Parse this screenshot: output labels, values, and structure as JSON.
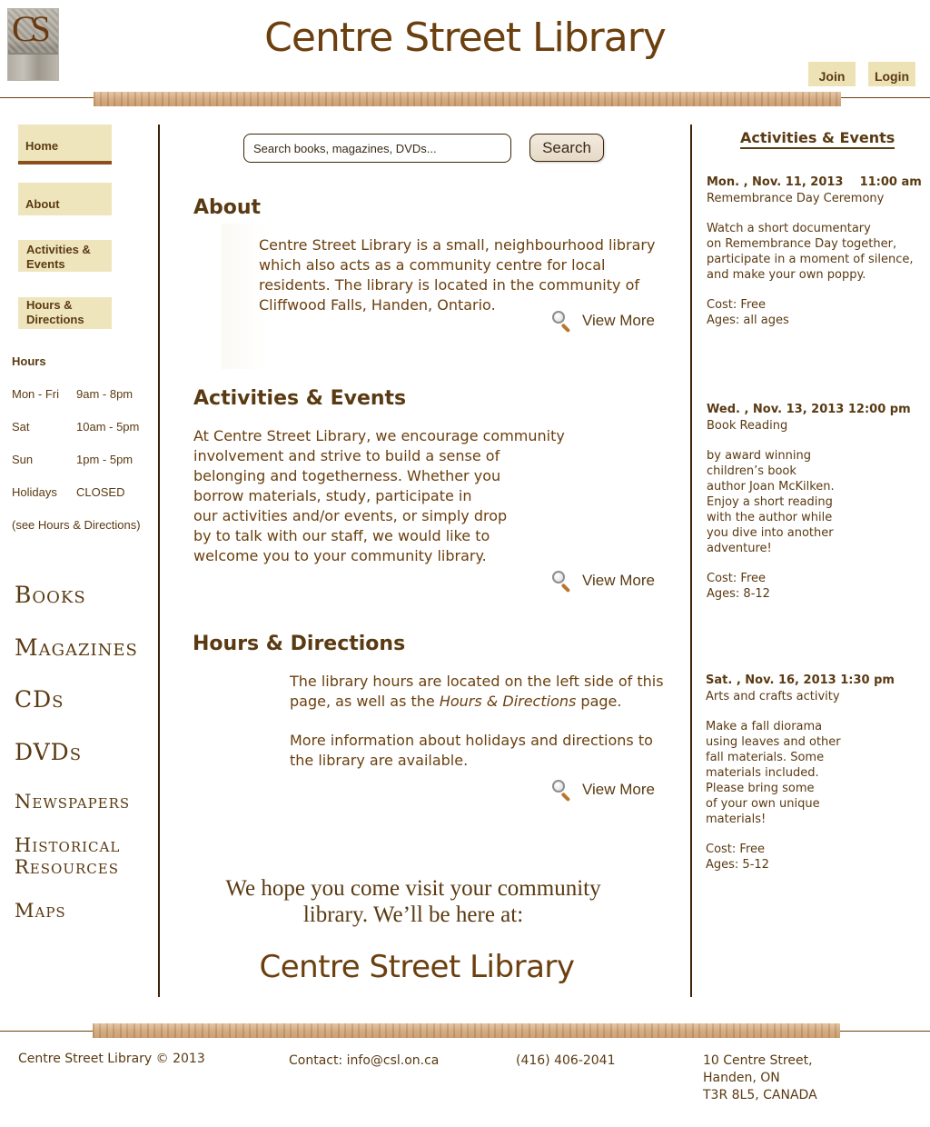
{
  "header": {
    "logo_text": "CS",
    "title": "Centre Street Library",
    "join_label": "Join",
    "login_label": "Login"
  },
  "nav": {
    "home": "Home",
    "about": "About",
    "activities": "Activities &\nEvents",
    "hours": "Hours &\nDirections"
  },
  "hours": {
    "title": "Hours",
    "rows": [
      {
        "day": "Mon - Fri",
        "time": "9am - 8pm"
      },
      {
        "day": "Sat",
        "time": "10am - 5pm"
      },
      {
        "day": "Sun",
        "time": "1pm - 5pm"
      },
      {
        "day": "Holidays",
        "time": "CLOSED"
      }
    ],
    "note": "(see Hours & Directions)"
  },
  "categories": [
    "Books",
    "Magazines",
    "CDs",
    "DVDs",
    "Newspapers",
    "Historical",
    "Resources",
    "Maps"
  ],
  "search": {
    "placeholder": "Search books, magazines, DVDs...",
    "button": "Search"
  },
  "about": {
    "title": "About",
    "text": "Centre Street Library is a small, neighbourhood library which also acts as a community centre for local residents. The library is located in the community of Cliffwood Falls, Handen, Ontario.",
    "view_more": "View More"
  },
  "activities": {
    "title": "Activities & Events",
    "lines": [
      "At Centre Street Library, we encourage community",
      "involvement and strive to build a sense of",
      "belonging and togetherness. Whether you",
      "borrow materials, study, participate in",
      "our activities and/or events, or simply drop",
      "by to talk with our staff, we would like to",
      "welcome you to your community library."
    ],
    "view_more": "View More"
  },
  "hours_directions": {
    "title": "Hours & Directions",
    "p1_a": "The library hours are located on the left side of this page, as well as the ",
    "p1_em": "Hours & Directions",
    "p1_b": " page.",
    "p2": "More information about holidays and directions to the library are available.",
    "view_more": "View More"
  },
  "closing": {
    "line1": "We hope you come visit your community",
    "line2": "library. We’ll be here at:",
    "name": "Centre Street Library"
  },
  "events": {
    "title": "Activities & Events",
    "items": [
      {
        "date": "Mon. , Nov. 11, 2013    11:00 am",
        "name": "Remembrance Day Ceremony",
        "desc": "Watch a short documentary\non Remembrance Day together,\nparticipate in a moment of silence,\nand make your own poppy.",
        "cost": "Cost: Free",
        "ages": "Ages: all ages"
      },
      {
        "date": "Wed. , Nov. 13, 2013 12:00 pm",
        "name": "Book Reading",
        "desc": "by award winning\nchildren’s book\nauthor Joan McKilken.\nEnjoy a short reading\nwith the author while\nyou dive into another\nadventure!",
        "cost": "Cost: Free",
        "ages": "Ages: 8-12"
      },
      {
        "date": "Sat. , Nov. 16, 2013 1:30 pm",
        "name": "Arts and crafts activity",
        "desc": "Make a fall diorama\nusing leaves and other\nfall materials. Some\nmaterials included.\nPlease bring some\nof your own unique\nmaterials!",
        "cost": "Cost: Free",
        "ages": "Ages: 5-12"
      }
    ]
  },
  "footer": {
    "copyright": "Centre Street Library © 2013",
    "contact": "Contact: info@csl.on.ca",
    "phone": "(416) 406-2041",
    "address": "10 Centre Street,\nHanden, ON\nT3R 8L5, CANADA"
  },
  "colors": {
    "brand_brown": "#5a3a12",
    "button_cream": "#efe5bd",
    "divider": "#3c2408"
  }
}
